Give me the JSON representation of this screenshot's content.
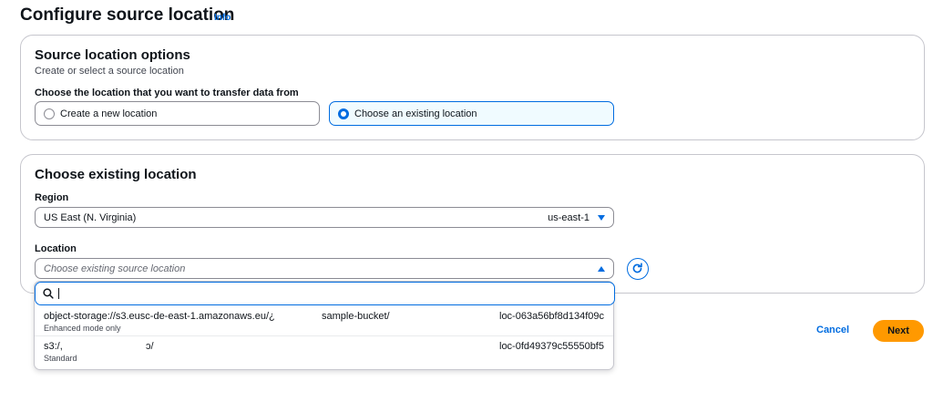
{
  "header": {
    "title": "Configure source location",
    "info_link": "Info"
  },
  "source_options": {
    "title": "Source location options",
    "description": "Create or select a source location",
    "question": "Choose the location that you want to transfer data from",
    "radio_options": [
      {
        "label": "Create a new location",
        "selected": false
      },
      {
        "label": "Choose an existing location",
        "selected": true
      }
    ]
  },
  "existing_location": {
    "title": "Choose existing location",
    "region": {
      "label": "Region",
      "value": "US East (N. Virginia)",
      "code": "us-east-1"
    },
    "location": {
      "label": "Location",
      "placeholder": "Choose existing source location",
      "refresh_icon": "refresh-icon"
    }
  },
  "dropdown": {
    "search_icon": "search-icon",
    "filter_value": "",
    "options": [
      {
        "uri": "object-storage://s3.eusc-de-east-1.amazonaws.eu/¿",
        "bucket": "sample-bucket/",
        "id": "loc-063a56bf8d134f09c",
        "tag": "Enhanced mode only"
      },
      {
        "uri": "s3:/,",
        "bucket": "ɔ/",
        "id": "loc-0fd49379c55550bf5",
        "tag": "Standard"
      }
    ]
  },
  "footer": {
    "cancel_label": "Cancel",
    "next_label": "Next"
  },
  "colors": {
    "accent": "#006ce0",
    "primary_button": "#ff9900",
    "border": "#c6c6cd"
  }
}
